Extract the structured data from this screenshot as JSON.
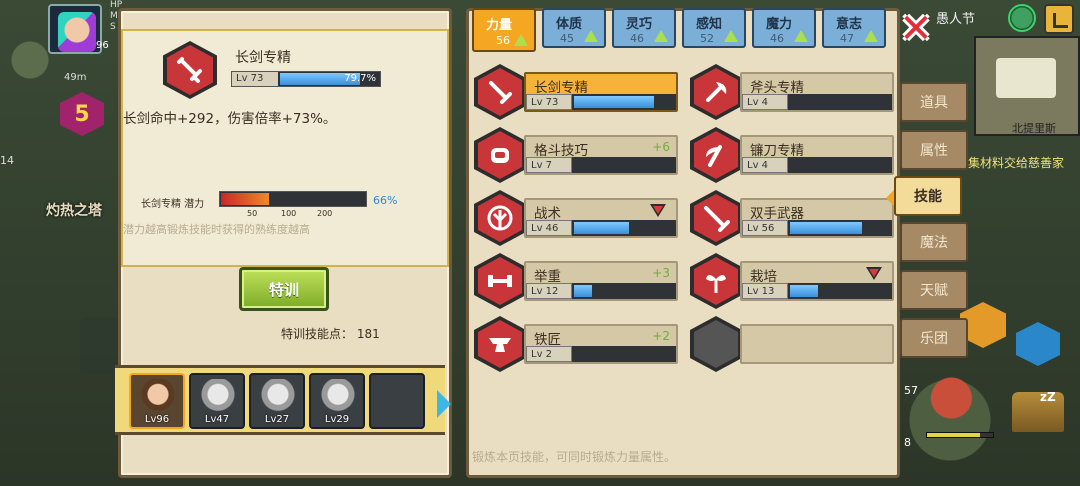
{
  "hud": {
    "level": "96",
    "stat_labels": [
      "HP",
      "M",
      "S"
    ],
    "distance": "49m",
    "badge_level": "5",
    "counter_left": "14",
    "tower_label": "灼热之塔",
    "holiday": "愚人节",
    "minimap_label": "北提里斯",
    "quest_text": "集材料交给慈善家",
    "count_57": "57",
    "count_8": "8"
  },
  "stat_tabs": [
    {
      "name": "力量",
      "value": "56",
      "active": true
    },
    {
      "name": "体质",
      "value": "45",
      "active": false
    },
    {
      "name": "灵巧",
      "value": "46",
      "active": false
    },
    {
      "name": "感知",
      "value": "52",
      "active": false
    },
    {
      "name": "魔力",
      "value": "46",
      "active": false
    },
    {
      "name": "意志",
      "value": "47",
      "active": false
    }
  ],
  "detail": {
    "title": "长剑专精",
    "level": "Lv 73",
    "progress": "79.7%",
    "progress_value": 79.7,
    "description": "长剑命中+292，伤害倍率+73%。",
    "potential_label": "长剑专精 潜力",
    "potential_ticks": [
      "50",
      "100",
      "200"
    ],
    "potential_pct": "66%",
    "potential_fraction": 0.33,
    "potential_note": "潜力越高锻炼技能时获得的熟练度越高",
    "train_button": "特训",
    "train_points_label": "特训技能点：",
    "train_points": "181"
  },
  "party": [
    {
      "level": "Lv96",
      "active": true
    },
    {
      "level": "Lv47",
      "active": false
    },
    {
      "level": "Lv27",
      "active": false
    },
    {
      "level": "Lv29",
      "active": false
    },
    {
      "level": "",
      "active": false
    }
  ],
  "skills": [
    {
      "name": "长剑专精",
      "level": "Lv 73",
      "fill": 0.8,
      "delta": "",
      "down": false,
      "icon": "sword-icon",
      "selected": true
    },
    {
      "name": "斧头专精",
      "level": "Lv 4",
      "fill": 0.0,
      "delta": "",
      "down": false,
      "icon": "axe-icon",
      "selected": false
    },
    {
      "name": "格斗技巧",
      "level": "Lv 7",
      "fill": 0.0,
      "delta": "+6",
      "down": false,
      "icon": "fist-icon",
      "selected": false
    },
    {
      "name": "镰刀专精",
      "level": "Lv 4",
      "fill": 0.0,
      "delta": "",
      "down": false,
      "icon": "scythe-icon",
      "selected": false
    },
    {
      "name": "战术",
      "level": "Lv 46",
      "fill": 0.55,
      "delta": "",
      "down": true,
      "icon": "tactics-icon",
      "selected": false
    },
    {
      "name": "双手武器",
      "level": "Lv 56",
      "fill": 0.72,
      "delta": "",
      "down": false,
      "icon": "two-handed-icon",
      "selected": false
    },
    {
      "name": "举重",
      "level": "Lv 12",
      "fill": 0.18,
      "delta": "+3",
      "down": false,
      "icon": "weightlift-icon",
      "selected": false
    },
    {
      "name": "栽培",
      "level": "Lv 13",
      "fill": 0.28,
      "delta": "",
      "down": true,
      "icon": "plant-icon",
      "selected": false
    },
    {
      "name": "铁匠",
      "level": "Lv 2",
      "fill": 0.0,
      "delta": "+2",
      "down": false,
      "icon": "anvil-icon",
      "selected": false
    },
    {
      "name": "",
      "level": "",
      "fill": 0,
      "delta": "",
      "down": false,
      "icon": "empty-slot-icon",
      "selected": false,
      "empty": true
    }
  ],
  "footer_hint": "锻炼本页技能，可同时锻炼力量属性。",
  "side_tabs": [
    {
      "label": "道具",
      "active": false
    },
    {
      "label": "属性",
      "active": false
    },
    {
      "label": "技能",
      "active": true
    },
    {
      "label": "魔法",
      "active": false
    },
    {
      "label": "天赋",
      "active": false
    },
    {
      "label": "乐团",
      "active": false
    }
  ],
  "colors": {
    "panel_bg": "#e9dec1",
    "accent_orange": "#f5a623",
    "skill_red": "#c8363a",
    "bar_blue": "#3b8fd9",
    "tab_blue": "#7bafd8",
    "train_green": "#7cac28"
  }
}
